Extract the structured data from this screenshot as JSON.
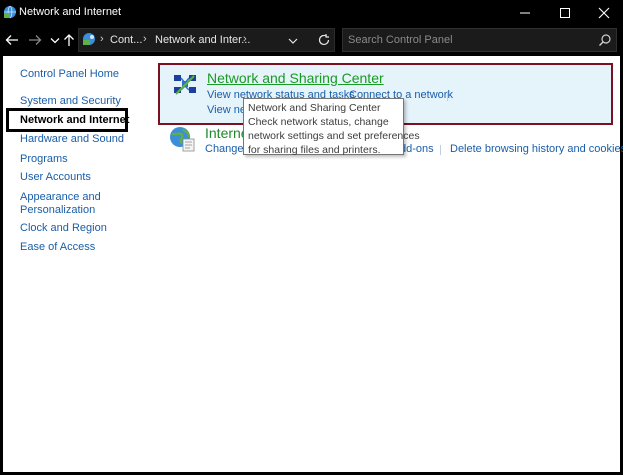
{
  "window": {
    "title": "Network and Internet",
    "controls": [
      "minimize",
      "maximize",
      "close"
    ]
  },
  "address_bar": {
    "breadcrumbs": [
      "Cont...",
      "Network and Inter..."
    ],
    "search_placeholder": "Search Control Panel"
  },
  "sidebar": {
    "items": [
      {
        "label": "Control Panel Home"
      },
      {
        "label": "System and Security"
      },
      {
        "label": "Network and Internet",
        "selected": true
      },
      {
        "label": "Hardware and Sound"
      },
      {
        "label": "Programs"
      },
      {
        "label": "User Accounts"
      },
      {
        "label": "Appearance and"
      },
      {
        "label": "Personalization"
      },
      {
        "label": "Clock and Region"
      },
      {
        "label": "Ease of Access"
      }
    ]
  },
  "categories": {
    "network_sharing": {
      "title": "Network and Sharing Center",
      "links": [
        "View network status and tasks",
        "Connect to a network",
        "View netw"
      ]
    },
    "internet_options": {
      "title": "Interne",
      "links": [
        "Change y",
        "dd-ons",
        "Delete browsing history and cookies"
      ]
    }
  },
  "tooltip": {
    "lines": [
      "Network and Sharing Center",
      "Check network status, change",
      "network settings and set preferences",
      "for sharing files and printers."
    ]
  },
  "colors": {
    "highlight_border": "#7a1020",
    "panel_hover_bg": "#e5f3fb",
    "link": "#1a5ea8",
    "category_title": "#1e8a2a"
  }
}
